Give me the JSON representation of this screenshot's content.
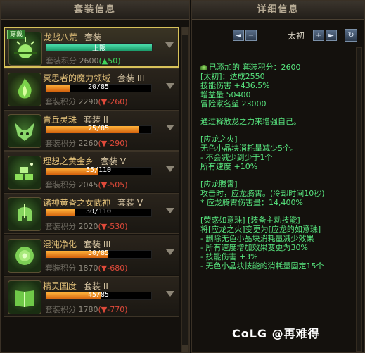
{
  "left_panel": {
    "title": "套装信息",
    "items": [
      {
        "badge": "穿戴",
        "name": "龙战八荒",
        "tier": "套装",
        "bar_text": "上限",
        "bar_fill": 1.0,
        "bar_color": "green",
        "score_label": "套装积分",
        "score": "2600",
        "delta": "(▲50)",
        "delta_dir": "up",
        "icon": "sun-icon",
        "selected": true
      },
      {
        "badge": "",
        "name": "冥思者的魔力领域",
        "tier": "套装 III",
        "bar_text": "20/85",
        "bar_fill": 0.235,
        "bar_color": "orange",
        "score_label": "套装积分",
        "score": "2290",
        "delta": "(▼-260)",
        "delta_dir": "down",
        "icon": "flame-icon",
        "selected": false
      },
      {
        "badge": "",
        "name": "青丘灵珠",
        "tier": "套装 II",
        "bar_text": "75/85",
        "bar_fill": 0.882,
        "bar_color": "orange",
        "score_label": "套装积分",
        "score": "2260",
        "delta": "(▼-290)",
        "delta_dir": "down",
        "icon": "fox-icon",
        "selected": false
      },
      {
        "badge": "",
        "name": "理想之黄金乡",
        "tier": "套装 V",
        "bar_text": "55/110",
        "bar_fill": 0.5,
        "bar_color": "orange",
        "score_label": "套装积分",
        "score": "2045",
        "delta": "(▼-505)",
        "delta_dir": "down",
        "icon": "gold-bars-icon",
        "selected": false
      },
      {
        "badge": "",
        "name": "诸神黄昏之女武神",
        "tier": "套装 V",
        "bar_text": "30/110",
        "bar_fill": 0.273,
        "bar_color": "orange",
        "score_label": "套装积分",
        "score": "2020",
        "delta": "(▼-530)",
        "delta_dir": "down",
        "icon": "helmet-icon",
        "selected": false
      },
      {
        "badge": "",
        "name": "混沌净化",
        "tier": "套装 III",
        "bar_text": "50/85",
        "bar_fill": 0.588,
        "bar_color": "orange",
        "score_label": "套装积分",
        "score": "1870",
        "delta": "(▼-680)",
        "delta_dir": "down",
        "icon": "rose-icon",
        "selected": false
      },
      {
        "badge": "",
        "name": "精灵国度",
        "tier": "套装 II",
        "bar_text": "45/85",
        "bar_fill": 0.529,
        "bar_color": "orange",
        "score_label": "套装积分",
        "score": "1780",
        "delta": "(▼-770)",
        "delta_dir": "down",
        "icon": "book-icon",
        "selected": false
      }
    ]
  },
  "right_panel": {
    "title": "详细信息",
    "nav": {
      "prev": "◄",
      "minus": "−",
      "current": "太初",
      "plus": "+",
      "next": "►"
    },
    "refresh": "↻",
    "head": {
      "text": "已添加的 套装积分：2600"
    },
    "stats": [
      "[太初]：达成2550",
      "技能伤害 +436.5%",
      "增益量 50400",
      "冒险家名望 23000"
    ],
    "intro": "通过释放龙之力来增强自己。",
    "sec1_title": "[应龙之火]",
    "sec1_lines": [
      "无色小晶块消耗量减少5个。",
      "- 不会减少到少于1个",
      "所有速度 +10%"
    ],
    "sec2_title": "[应龙腾霄]",
    "sec2_lines": [
      "攻击时，应龙腾霄。(冷却时间10秒)",
      "* 应龙腾霄伤害量：14,400%"
    ],
    "sec3_title": "[荧惑如意珠] [装备主动技能]",
    "sec3_lines": [
      "将[应龙之火]变更为[应龙的如意珠]",
      "- 删除无色小晶块消耗量减少效果",
      "- 所有速度增加效果变更为30%",
      "- 技能伤害 +3%",
      "- 无色小晶块技能的消耗量固定15个"
    ]
  },
  "watermark": {
    "logo": "CoLG",
    "text": "@再难得"
  },
  "colors": {
    "accent": "#d8c25a",
    "up": "#3fd35a",
    "down": "#e04a3a",
    "detail_text": "#57e57e"
  }
}
